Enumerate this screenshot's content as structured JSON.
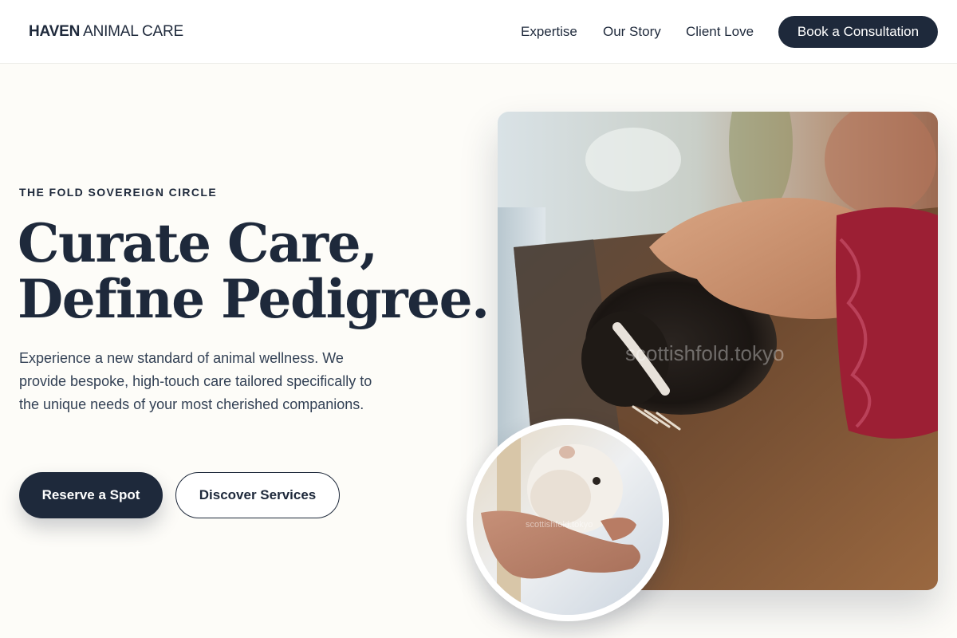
{
  "header": {
    "logo_bold": "HAVEN",
    "logo_light": "ANIMAL CARE",
    "nav": [
      {
        "label": "Expertise"
      },
      {
        "label": "Our Story"
      },
      {
        "label": "Client Love"
      }
    ],
    "cta_label": "Book a Consultation"
  },
  "hero": {
    "eyebrow": "THE FOLD SOVEREIGN CIRCLE",
    "headline_line1": "Curate Care,",
    "headline_line2": "Define Pedigree.",
    "description": "Experience a new standard of animal wellness. We provide bespoke, high-touch care tailored specifically to the unique needs of your most cherished companions.",
    "primary_button": "Reserve a Spot",
    "secondary_button": "Discover Services"
  },
  "images": {
    "main_watermark": "scottishfold.tokyo",
    "inset_watermark": "scottishfold.tokyo"
  },
  "colors": {
    "brand_navy": "#1e293b",
    "page_background": "#fdfcf8",
    "header_background": "#ffffff",
    "body_text": "#334155"
  }
}
